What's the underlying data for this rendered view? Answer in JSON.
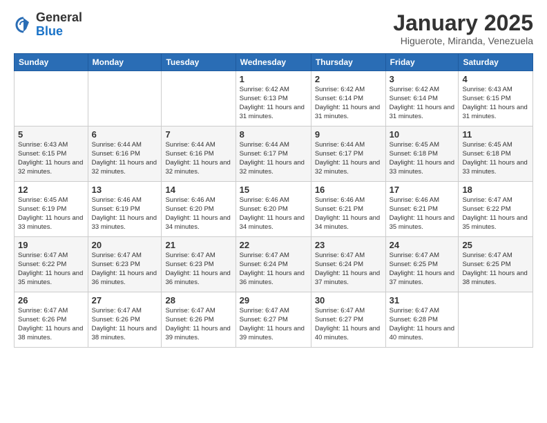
{
  "header": {
    "logo_general": "General",
    "logo_blue": "Blue",
    "month_title": "January 2025",
    "subtitle": "Higuerote, Miranda, Venezuela"
  },
  "days_of_week": [
    "Sunday",
    "Monday",
    "Tuesday",
    "Wednesday",
    "Thursday",
    "Friday",
    "Saturday"
  ],
  "weeks": [
    [
      {
        "day": "",
        "info": ""
      },
      {
        "day": "",
        "info": ""
      },
      {
        "day": "",
        "info": ""
      },
      {
        "day": "1",
        "info": "Sunrise: 6:42 AM\nSunset: 6:13 PM\nDaylight: 11 hours\nand 31 minutes."
      },
      {
        "day": "2",
        "info": "Sunrise: 6:42 AM\nSunset: 6:14 PM\nDaylight: 11 hours\nand 31 minutes."
      },
      {
        "day": "3",
        "info": "Sunrise: 6:42 AM\nSunset: 6:14 PM\nDaylight: 11 hours\nand 31 minutes."
      },
      {
        "day": "4",
        "info": "Sunrise: 6:43 AM\nSunset: 6:15 PM\nDaylight: 11 hours\nand 31 minutes."
      }
    ],
    [
      {
        "day": "5",
        "info": "Sunrise: 6:43 AM\nSunset: 6:15 PM\nDaylight: 11 hours\nand 32 minutes."
      },
      {
        "day": "6",
        "info": "Sunrise: 6:44 AM\nSunset: 6:16 PM\nDaylight: 11 hours\nand 32 minutes."
      },
      {
        "day": "7",
        "info": "Sunrise: 6:44 AM\nSunset: 6:16 PM\nDaylight: 11 hours\nand 32 minutes."
      },
      {
        "day": "8",
        "info": "Sunrise: 6:44 AM\nSunset: 6:17 PM\nDaylight: 11 hours\nand 32 minutes."
      },
      {
        "day": "9",
        "info": "Sunrise: 6:44 AM\nSunset: 6:17 PM\nDaylight: 11 hours\nand 32 minutes."
      },
      {
        "day": "10",
        "info": "Sunrise: 6:45 AM\nSunset: 6:18 PM\nDaylight: 11 hours\nand 33 minutes."
      },
      {
        "day": "11",
        "info": "Sunrise: 6:45 AM\nSunset: 6:18 PM\nDaylight: 11 hours\nand 33 minutes."
      }
    ],
    [
      {
        "day": "12",
        "info": "Sunrise: 6:45 AM\nSunset: 6:19 PM\nDaylight: 11 hours\nand 33 minutes."
      },
      {
        "day": "13",
        "info": "Sunrise: 6:46 AM\nSunset: 6:19 PM\nDaylight: 11 hours\nand 33 minutes."
      },
      {
        "day": "14",
        "info": "Sunrise: 6:46 AM\nSunset: 6:20 PM\nDaylight: 11 hours\nand 34 minutes."
      },
      {
        "day": "15",
        "info": "Sunrise: 6:46 AM\nSunset: 6:20 PM\nDaylight: 11 hours\nand 34 minutes."
      },
      {
        "day": "16",
        "info": "Sunrise: 6:46 AM\nSunset: 6:21 PM\nDaylight: 11 hours\nand 34 minutes."
      },
      {
        "day": "17",
        "info": "Sunrise: 6:46 AM\nSunset: 6:21 PM\nDaylight: 11 hours\nand 35 minutes."
      },
      {
        "day": "18",
        "info": "Sunrise: 6:47 AM\nSunset: 6:22 PM\nDaylight: 11 hours\nand 35 minutes."
      }
    ],
    [
      {
        "day": "19",
        "info": "Sunrise: 6:47 AM\nSunset: 6:22 PM\nDaylight: 11 hours\nand 35 minutes."
      },
      {
        "day": "20",
        "info": "Sunrise: 6:47 AM\nSunset: 6:23 PM\nDaylight: 11 hours\nand 36 minutes."
      },
      {
        "day": "21",
        "info": "Sunrise: 6:47 AM\nSunset: 6:23 PM\nDaylight: 11 hours\nand 36 minutes."
      },
      {
        "day": "22",
        "info": "Sunrise: 6:47 AM\nSunset: 6:24 PM\nDaylight: 11 hours\nand 36 minutes."
      },
      {
        "day": "23",
        "info": "Sunrise: 6:47 AM\nSunset: 6:24 PM\nDaylight: 11 hours\nand 37 minutes."
      },
      {
        "day": "24",
        "info": "Sunrise: 6:47 AM\nSunset: 6:25 PM\nDaylight: 11 hours\nand 37 minutes."
      },
      {
        "day": "25",
        "info": "Sunrise: 6:47 AM\nSunset: 6:25 PM\nDaylight: 11 hours\nand 38 minutes."
      }
    ],
    [
      {
        "day": "26",
        "info": "Sunrise: 6:47 AM\nSunset: 6:26 PM\nDaylight: 11 hours\nand 38 minutes."
      },
      {
        "day": "27",
        "info": "Sunrise: 6:47 AM\nSunset: 6:26 PM\nDaylight: 11 hours\nand 38 minutes."
      },
      {
        "day": "28",
        "info": "Sunrise: 6:47 AM\nSunset: 6:26 PM\nDaylight: 11 hours\nand 39 minutes."
      },
      {
        "day": "29",
        "info": "Sunrise: 6:47 AM\nSunset: 6:27 PM\nDaylight: 11 hours\nand 39 minutes."
      },
      {
        "day": "30",
        "info": "Sunrise: 6:47 AM\nSunset: 6:27 PM\nDaylight: 11 hours\nand 40 minutes."
      },
      {
        "day": "31",
        "info": "Sunrise: 6:47 AM\nSunset: 6:28 PM\nDaylight: 11 hours\nand 40 minutes."
      },
      {
        "day": "",
        "info": ""
      }
    ]
  ]
}
